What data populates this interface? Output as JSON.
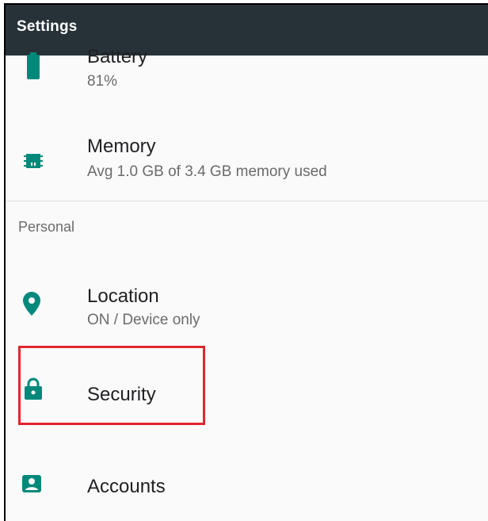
{
  "app": {
    "title": "Settings"
  },
  "items": {
    "battery": {
      "label": "Battery",
      "subtitle": "81%",
      "icon": "battery-icon"
    },
    "memory": {
      "label": "Memory",
      "subtitle": "Avg 1.0 GB of 3.4 GB memory used",
      "icon": "memory-chip-icon"
    },
    "location": {
      "label": "Location",
      "subtitle": "ON / Device only",
      "icon": "location-pin-icon"
    },
    "security": {
      "label": "Security",
      "icon": "lock-icon"
    },
    "accounts": {
      "label": "Accounts",
      "icon": "account-icon"
    }
  },
  "sections": {
    "personal": "Personal"
  },
  "colors": {
    "appbar": "#263238",
    "accent": "#00897b",
    "highlight": "#e0262c"
  }
}
